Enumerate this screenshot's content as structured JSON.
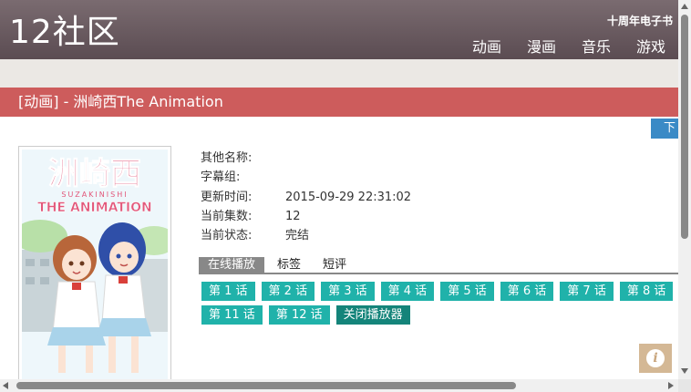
{
  "header": {
    "logo": "12社区",
    "ebook_link": "十周年电子书",
    "nav": [
      "动画",
      "漫画",
      "音乐",
      "游戏"
    ]
  },
  "title_bar": "[动画] - 洲崎西The Animation",
  "download_label": "下",
  "poster": {
    "title_cn": "洲崎西",
    "title_romaji": "SUZAKINISHI",
    "title_en": "THE ANIMATION"
  },
  "info": [
    {
      "label": "其他名称:",
      "value": ""
    },
    {
      "label": "字幕组:",
      "value": ""
    },
    {
      "label": "更新时间:",
      "value": "2015-09-29 22:31:02"
    },
    {
      "label": "当前集数:",
      "value": "12"
    },
    {
      "label": "当前状态:",
      "value": "完结"
    }
  ],
  "tabs": [
    "在线播放",
    "标签",
    "短评"
  ],
  "episodes": [
    "第 1 话",
    "第 2 话",
    "第 3 话",
    "第 4 话",
    "第 5 话",
    "第 6 话",
    "第 7 话",
    "第 8 话",
    "第 11 话",
    "第 12 话"
  ],
  "close_player": "关闭播放器",
  "info_icon": "info-icon",
  "colors": {
    "header": "#6b5c62",
    "title_bar": "#cd5c5c",
    "episode": "#20b2aa",
    "close": "#14847a",
    "download": "#3a8ac6"
  }
}
